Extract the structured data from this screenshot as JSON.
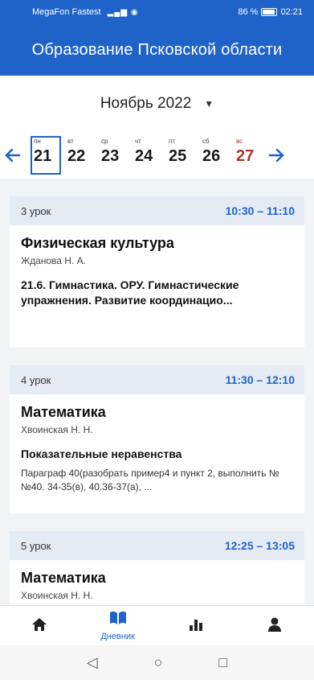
{
  "status_bar": {
    "carrier": "MegaFon Fastest",
    "battery": "86 %",
    "time": "02:21",
    "color": "#1f63c9"
  },
  "app_bar": {
    "title": "Образование Псковской области"
  },
  "calendar": {
    "month": "Ноябрь 2022",
    "days": [
      {
        "dow": "ПН",
        "num": "21"
      },
      {
        "dow": "ВТ",
        "num": "22"
      },
      {
        "dow": "СР",
        "num": "23"
      },
      {
        "dow": "ЧТ",
        "num": "24"
      },
      {
        "dow": "ПТ",
        "num": "25"
      },
      {
        "dow": "СБ",
        "num": "26"
      },
      {
        "dow": "ВС",
        "num": "27"
      }
    ],
    "selected_index": 0
  },
  "lessons": [
    {
      "number": "3 урок",
      "time": "10:30 – 11:10",
      "subject": "Физическая культура",
      "teacher": "Жданова Н. А.",
      "topic": "21.6. Гимнастика. ОРУ. Гимнастические упражнения. Развитие координацио...",
      "homework": ""
    },
    {
      "number": "4 урок",
      "time": "11:30 – 12:10",
      "subject": "Математика",
      "teacher": "Хвоинская Н. Н.",
      "topic": "Показательные неравенства",
      "homework": "Параграф 40(разобрать пример4 и пункт 2, выполнить №№40. 34-35(в), 40.36-37(а), ..."
    },
    {
      "number": "5 урок",
      "time": "12:25 – 13:05",
      "subject": "Математика",
      "teacher": "Хвоинская Н. Н."
    }
  ],
  "bottom_nav": {
    "items": [
      {
        "icon": "home-icon",
        "label": ""
      },
      {
        "icon": "diary-icon",
        "label": "Дневник"
      },
      {
        "icon": "stats-icon",
        "label": ""
      },
      {
        "icon": "profile-icon",
        "label": ""
      }
    ],
    "active_index": 1
  }
}
